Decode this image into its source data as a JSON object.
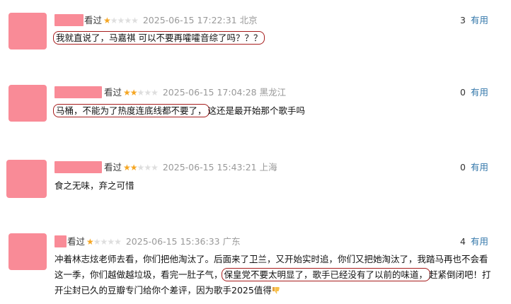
{
  "comments": [
    {
      "watched": "看过",
      "rating": 1,
      "time": "2025-06-15 17:22:31",
      "location": "北京",
      "votes": "3",
      "useful": "有用",
      "text_parts": [
        {
          "text": "我就直说了，马嘉祺 可以不要再嚯嚯音综了吗？？？",
          "hl": true
        }
      ]
    },
    {
      "watched": "看过",
      "rating": 2,
      "time": "2025-06-15 17:04:28",
      "location": "黑龙江",
      "votes": "0",
      "useful": "有用",
      "text_parts": [
        {
          "text": "马桶，不能为了热度连底线都不要了，",
          "hl": true
        },
        {
          "text": "这还是最开始那个歌手吗",
          "hl": false
        }
      ]
    },
    {
      "watched": "看过",
      "rating": 2,
      "time": "2025-06-15 15:43:21",
      "location": "上海",
      "votes": "0",
      "useful": "有用",
      "text_parts": [
        {
          "text": "食之无味，弃之可惜",
          "hl": false
        }
      ]
    },
    {
      "watched": "看过",
      "rating": 1,
      "time": "2025-06-15 15:36:33",
      "location": "广东",
      "votes": "4",
      "useful": "有用",
      "text_parts": [
        {
          "text": "冲着林志炫老师去看，你们把他淘汰了。后面来了卫兰，又开始实时追，你们又把她淘汰了，我踏马再也不会看这一季，你们越做越垃圾，看完一肚子气，",
          "hl": false
        },
        {
          "text": "保皇党不要太明显了，歌手已经没有了以前的味道，",
          "hl": true
        },
        {
          "text": "赶紧倒闭吧！打开尘封已久的豆瓣专门给你个差评，因为歌手2025值得",
          "hl": false
        }
      ],
      "end_icon": "thumbs-down-icon"
    }
  ],
  "colors": {
    "avatar": "#f98b97",
    "star_on": "#f5a623",
    "star_off": "#dedede",
    "link": "#3377aa",
    "highlight_border": "#a61c1c"
  }
}
